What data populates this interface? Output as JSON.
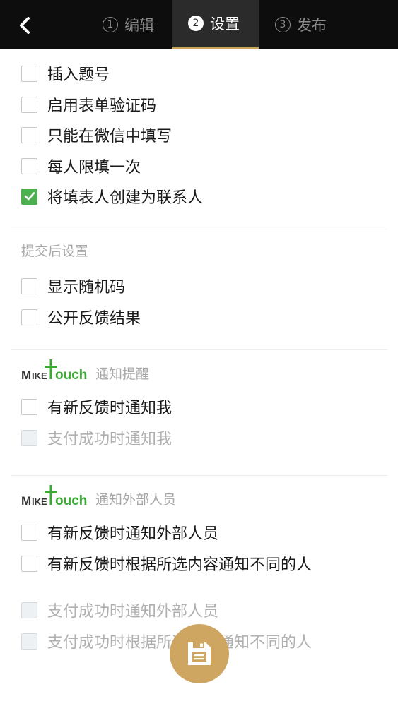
{
  "header": {
    "tabs": [
      {
        "num": "1",
        "label": "编辑"
      },
      {
        "num": "2",
        "label": "设置"
      },
      {
        "num": "3",
        "label": "发布"
      }
    ]
  },
  "general_options": [
    {
      "label": "插入题号",
      "checked": false
    },
    {
      "label": "启用表单验证码",
      "checked": false
    },
    {
      "label": "只能在微信中填写",
      "checked": false
    },
    {
      "label": "每人限填一次",
      "checked": false
    },
    {
      "label": "将填表人创建为联系人",
      "checked": true
    }
  ],
  "after_submit": {
    "title": "提交后设置",
    "options": [
      {
        "label": "显示随机码",
        "checked": false
      },
      {
        "label": "公开反馈结果",
        "checked": false
      }
    ]
  },
  "brand": {
    "logo_text": "MIKETouch"
  },
  "notify": {
    "title": "通知提醒",
    "options": [
      {
        "label": "有新反馈时通知我",
        "checked": false,
        "disabled": false
      },
      {
        "label": "支付成功时通知我",
        "checked": false,
        "disabled": true
      }
    ]
  },
  "notify_external": {
    "title": "通知外部人员",
    "options": [
      {
        "label": "有新反馈时通知外部人员",
        "checked": false,
        "disabled": false
      },
      {
        "label": "有新反馈时根据所选内容通知不同的人",
        "checked": false,
        "disabled": false
      },
      {
        "label": "支付成功时通知外部人员",
        "checked": false,
        "disabled": true
      },
      {
        "label": "支付成功时根据所选内容通知不同的人",
        "checked": false,
        "disabled": true
      }
    ]
  },
  "colors": {
    "accent": "#cea662",
    "check": "#4caf50",
    "topbar": "#0d0d0d"
  },
  "icons": {
    "back": "chevron-left-icon",
    "save": "save-icon"
  }
}
